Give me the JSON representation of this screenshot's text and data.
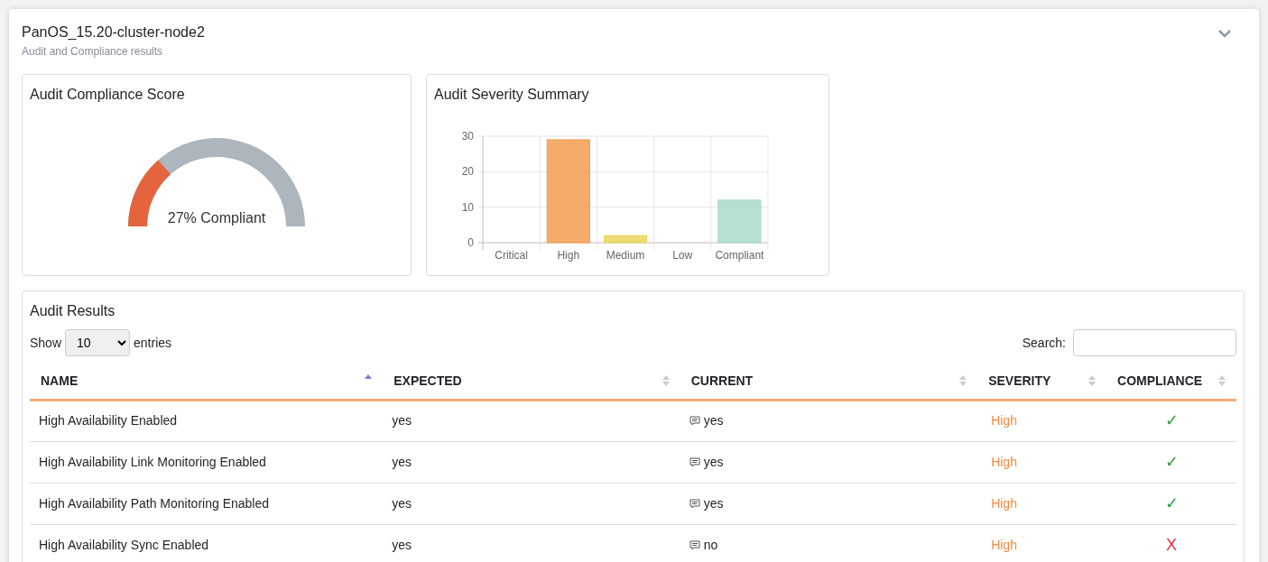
{
  "header": {
    "title": "PanOS_15.20-cluster-node2",
    "subtitle": "Audit and Compliance results",
    "expanded": true
  },
  "score_card": {
    "title": "Audit Compliance Score",
    "level": 0.27,
    "reading": "27% Compliant"
  },
  "severity_card": {
    "title": "Audit Severity Summary",
    "chart_data": {
      "type": "bar",
      "categories": [
        "Critical",
        "High",
        "Medium",
        "Low",
        "Compliant"
      ],
      "series": [
        {
          "color": "#f39c4f",
          "values": [
            null,
            29,
            null,
            null,
            null
          ]
        },
        {
          "color": "#e8d65a",
          "values": [
            null,
            null,
            2,
            null,
            null
          ]
        },
        {
          "color": "#a8dbc9",
          "values": [
            null,
            null,
            null,
            null,
            12
          ]
        }
      ],
      "ylim": [
        0,
        30
      ],
      "yticks": [
        0,
        10,
        20,
        30
      ]
    }
  },
  "results": {
    "title": "Audit Results",
    "show_label": "Show",
    "page_size": "10",
    "entries_label": "entries",
    "search_label": "Search:",
    "columns": [
      {
        "label": "NAME",
        "sorted": true
      },
      {
        "label": "EXPECTED",
        "sorted": false
      },
      {
        "label": "CURRENT",
        "sorted": false
      },
      {
        "label": "SEVERITY",
        "sorted": false
      },
      {
        "label": "COMPLIANCE",
        "sorted": false
      }
    ],
    "rows": [
      {
        "name": "High Availability Enabled",
        "expected": "yes",
        "current": "yes",
        "severity": "High",
        "mark": "✓",
        "compliant": true
      },
      {
        "name": "High Availability Link Monitoring Enabled",
        "expected": "yes",
        "current": "yes",
        "severity": "High",
        "mark": "✓",
        "compliant": true
      },
      {
        "name": "High Availability Path Monitoring Enabled",
        "expected": "yes",
        "current": "yes",
        "severity": "High",
        "mark": "✓",
        "compliant": true
      },
      {
        "name": "High Availability Sync Enabled",
        "expected": "yes",
        "current": "no",
        "severity": "High",
        "mark": "X",
        "compliant": false
      }
    ]
  }
}
